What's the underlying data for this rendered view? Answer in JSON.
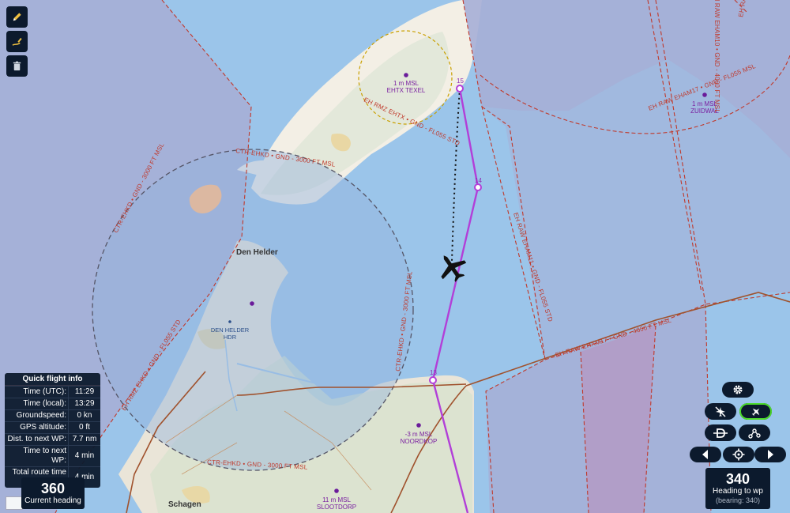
{
  "toolbar": {
    "items": [
      {
        "name": "pencil-icon"
      },
      {
        "name": "hand-pen-icon"
      },
      {
        "name": "trash-icon"
      }
    ]
  },
  "map": {
    "towns": [
      {
        "id": "den-helder",
        "name": "Den Helder"
      },
      {
        "id": "schagen",
        "name": "Schagen"
      }
    ],
    "airfields": [
      {
        "id": "texel",
        "elev": "1 m MSL",
        "name": "EHTX TEXEL"
      },
      {
        "id": "zuidwal",
        "elev": "1 m MSL",
        "name": "ZUIDWAL"
      },
      {
        "id": "noordkop",
        "elev": "-3 m MSL",
        "name": "NOORDKOP"
      },
      {
        "id": "slootdorp",
        "elev": "11 m MSL",
        "name": "SLOOTDORP"
      },
      {
        "id": "den-helder-hdr",
        "elev": "DEN HELDER",
        "name": "HDR"
      }
    ],
    "waypoints": [
      "15",
      "14",
      "13"
    ],
    "airspaces": [
      "CTR-EHKD • GND - 3000 FT MSL",
      "CTR-EHKD • GND - 3000 FT MSL",
      "CTR-EHKD • GND - 3000 FT MSL",
      "CTR-EHKD • GND - 3000 FT MSL",
      "EH RAW EHAM17 • GND - FL055 MSL",
      "EH RAW EHAM19 • GND - FL055 STD",
      "EH RMZ EHTX • GND - FL055 STD",
      "EH RMZ EHKD • GND - FL055 STD",
      "EH RAW EHAM17 • GND - 4000 FT MSL",
      "EH RAW EHAM11 • GND - FL055 STD",
      "EH RAW EHAM10 • GND - 4000 FT MSL"
    ]
  },
  "quick_info": {
    "title": "Quick flight info",
    "rows": [
      {
        "label": "Time (UTC):",
        "value": "11:29"
      },
      {
        "label": "Time (local):",
        "value": "13:29"
      },
      {
        "label": "Groundspeed:",
        "value": "0 kn"
      },
      {
        "label": "GPS altitude:",
        "value": "0 ft"
      },
      {
        "label": "Dist. to next WP:",
        "value": "7.7 nm"
      },
      {
        "label": "Time to next WP:",
        "value": "4 min"
      },
      {
        "label": "Total route time remaining:",
        "value": "4 min"
      }
    ]
  },
  "heading": {
    "value": "360",
    "label": "Current heading"
  },
  "wp_heading": {
    "value": "340",
    "label": "Heading to wp",
    "bearing": "(bearing: 340)"
  },
  "controls": {
    "settings": "gear-icon",
    "follow_off": "airplane-off-icon",
    "follow_on": "airplane-follow-icon",
    "direct_to": "direct-to-icon",
    "route": "route-icon",
    "prev": "arrow-left-icon",
    "center": "crosshair-icon",
    "next": "arrow-right-icon"
  },
  "colors": {
    "route": "#b23fd8",
    "airspace": "#d0342c",
    "panel": "#0c1a2d",
    "active": "#4ddc2a"
  }
}
